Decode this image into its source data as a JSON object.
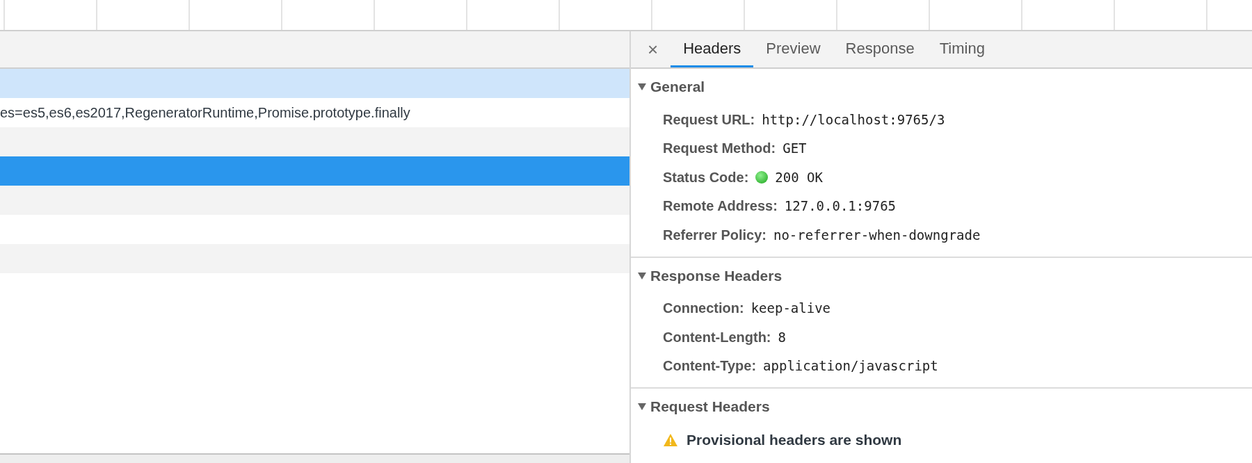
{
  "request_list": {
    "rows": [
      {
        "name": "",
        "selected": false,
        "hovered": true
      },
      {
        "name": "es=es5,es6,es2017,RegeneratorRuntime,Promise.prototype.finally",
        "selected": false,
        "hovered": false
      },
      {
        "name": "",
        "selected": false,
        "hovered": false
      },
      {
        "name": "",
        "selected": true,
        "hovered": false
      },
      {
        "name": "",
        "selected": false,
        "hovered": false
      },
      {
        "name": "",
        "selected": false,
        "hovered": false
      },
      {
        "name": "",
        "selected": false,
        "hovered": false
      }
    ]
  },
  "details": {
    "close": "×",
    "tabs": [
      {
        "label": "Headers",
        "selected": true
      },
      {
        "label": "Preview",
        "selected": false
      },
      {
        "label": "Response",
        "selected": false
      },
      {
        "label": "Timing",
        "selected": false
      }
    ],
    "sections": [
      {
        "title": "General",
        "expanded": true,
        "fields": [
          {
            "name": "Request URL:",
            "value": "http://localhost:9765/3"
          },
          {
            "name": "Request Method:",
            "value": "GET"
          },
          {
            "name": "Status Code:",
            "value": "200 OK",
            "kind": "status"
          },
          {
            "name": "Remote Address:",
            "value": "127.0.0.1:9765"
          },
          {
            "name": "Referrer Policy:",
            "value": "no-referrer-when-downgrade"
          }
        ]
      },
      {
        "title": "Response Headers",
        "expanded": true,
        "fields": [
          {
            "name": "Connection:",
            "value": "keep-alive"
          },
          {
            "name": "Content-Length:",
            "value": "8"
          },
          {
            "name": "Content-Type:",
            "value": "application/javascript"
          }
        ]
      },
      {
        "title": "Request Headers",
        "expanded": true,
        "warning": "Provisional headers are shown"
      }
    ]
  }
}
